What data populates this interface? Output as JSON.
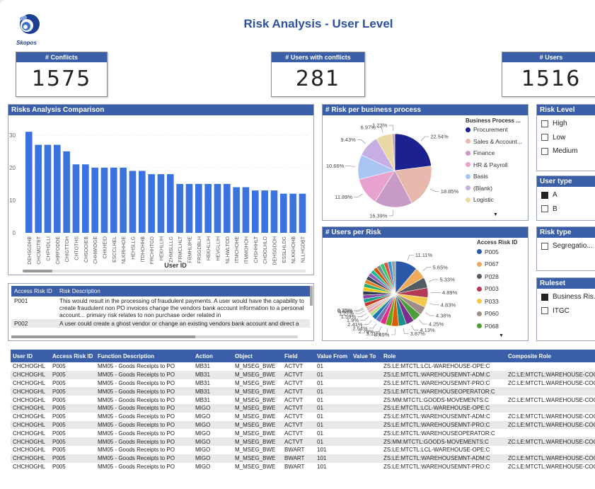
{
  "brand": {
    "name": "Skopos"
  },
  "page_title": "Risk Analysis - User Level",
  "kpis": [
    {
      "label": "# Conflicts",
      "value": "1575"
    },
    {
      "label": "# Users with conflicts",
      "value": "281"
    },
    {
      "label": "# Users",
      "value": "1516"
    }
  ],
  "risks_chart": {
    "title": "Risks Analysis Comparison",
    "x_axis_title": "User ID",
    "y_ticks": [
      "0",
      "10",
      "20",
      "30"
    ]
  },
  "business_process_chart": {
    "title": "# Risk per business process",
    "legend_title": "Business Process ...",
    "slices": [
      {
        "label": "Procurement",
        "value": 22.54,
        "pct": "22.54%",
        "color": "#1c2190"
      },
      {
        "label": "Sales & Account...",
        "value": 18.85,
        "pct": "18.85%",
        "color": "#e8b8ad"
      },
      {
        "label": "Finance",
        "value": 16.39,
        "pct": "16.39%",
        "color": "#c89ac6"
      },
      {
        "label": "HR & Payroll",
        "value": 11.89,
        "pct": "11.89%",
        "color": "#e8a2cf"
      },
      {
        "label": "Basis",
        "value": 10.66,
        "pct": "10.66%",
        "color": "#a9c5f3"
      },
      {
        "label": "(Blank)",
        "value": 9.43,
        "pct": "9.43%",
        "color": "#c6aee3"
      },
      {
        "label": "Logistic",
        "value": 6.97,
        "pct": "6.97%",
        "color": "#ebd9a5"
      },
      {
        "label": "",
        "value": 1.23,
        "pct": "1.23%",
        "color": "#d7a0a0"
      }
    ]
  },
  "users_per_risk_chart": {
    "title": "# Users per Risk",
    "legend_title": "Access Risk ID",
    "legend": [
      {
        "label": "P005",
        "color": "#2a57a8"
      },
      {
        "label": "P067",
        "color": "#f0ab5a"
      },
      {
        "label": "P028",
        "color": "#555b63"
      },
      {
        "label": "P003",
        "color": "#b43b56"
      },
      {
        "label": "P033",
        "color": "#f3c84b"
      },
      {
        "label": "P060",
        "color": "#a08e86"
      },
      {
        "label": "P068",
        "color": "#4c9e38"
      }
    ],
    "labeled_slices": [
      {
        "value": 11.11,
        "pct": "11.11%",
        "color": "#2a57a8"
      },
      {
        "value": 5.65,
        "pct": "5.65%",
        "color": "#f0ab5a"
      },
      {
        "value": 5.33,
        "pct": "5.33%",
        "color": "#555b63"
      },
      {
        "value": 4.89,
        "pct": "4.89%",
        "color": "#b43b56"
      },
      {
        "value": 4.83,
        "pct": "4.83%",
        "color": "#f3c84b"
      },
      {
        "value": 4.38,
        "pct": "4.38%",
        "color": "#a08e86"
      },
      {
        "value": 4.25,
        "pct": "4.25%",
        "color": "#4c9e38"
      },
      {
        "value": 4.13,
        "pct": "4.13%",
        "color": "#7a2f8c"
      },
      {
        "value": 3.87,
        "pct": "3.87%",
        "color": "#1b8f8a"
      },
      {
        "value": 3.49,
        "pct": "3.49%",
        "color": "#d95f02"
      },
      {
        "value": 3.11,
        "pct": "3.11%",
        "color": "#66a61e"
      },
      {
        "value": 2.79,
        "pct": "2.79%",
        "color": "#e7298a"
      },
      {
        "value": 2.54,
        "pct": "2.54%",
        "color": "#7570b3"
      },
      {
        "value": 2.41,
        "pct": "2.41%",
        "color": "#1f78b4"
      },
      {
        "value": 1.9,
        "pct": "1.9%",
        "color": "#b2df8a"
      },
      {
        "value": 1.59,
        "pct": "1.59%",
        "color": "#fb9a99"
      },
      {
        "value": 1.27,
        "pct": "1.27%",
        "color": "#cab2d6"
      },
      {
        "value": 0.63,
        "pct": "0.63%",
        "color": "#ff7f00"
      },
      {
        "value": 0.25,
        "pct": "0.25%",
        "color": "#6a3d9a"
      }
    ]
  },
  "slicers": {
    "risk_level": {
      "title": "Risk Level",
      "items": [
        {
          "label": "High",
          "checked": false
        },
        {
          "label": "Low",
          "checked": false
        },
        {
          "label": "Medium",
          "checked": false
        }
      ]
    },
    "user_type": {
      "title": "User type",
      "items": [
        {
          "label": "A",
          "checked": true
        },
        {
          "label": "B",
          "checked": false
        }
      ]
    },
    "risk_type": {
      "title": "Risk type",
      "items": [
        {
          "label": "Segregatio...",
          "checked": false
        }
      ]
    },
    "ruleset": {
      "title": "Ruleset",
      "items": [
        {
          "label": "Business Ris...",
          "checked": true
        },
        {
          "label": "ITGC",
          "checked": false
        }
      ]
    }
  },
  "risk_table": {
    "headers": {
      "id": "Access Risk ID",
      "desc": "Risk Description"
    },
    "rows": [
      {
        "id": "P001",
        "desc": "This would result in the processing of fraudulent payments. A user would have the capability to create fraudulent non PO invoices change the vendors bank account information to a personal account... primary risk relates to non purchase order related in"
      },
      {
        "id": "P002",
        "desc": "A user could create a ghost vendor or change an existing vendors bank account and direct a"
      }
    ]
  },
  "detail_table": {
    "headers": [
      "User ID",
      "Access Risk ID",
      "Function Description",
      "Action",
      "Object",
      "Field",
      "Value From",
      "Value To",
      "Role",
      "Composite Role"
    ],
    "rows": [
      [
        "CHCHOGHL",
        "P005",
        "MM05 - Goods Receipts to PO",
        "MB31",
        "M_MSEG_BWE",
        "ACTVT",
        "01",
        "",
        "ZS:LE:MTCTL:LCL-WAREHOUSE-OPE:C",
        ""
      ],
      [
        "CHCHOGHL",
        "P005",
        "MM05 - Goods Receipts to PO",
        "MB31",
        "M_MSEG_BWE",
        "ACTVT",
        "01",
        "",
        "ZS:LE:MTCTL:WAREHOUSEMNT-ADM:C",
        "ZC:LE:MTCTL:WAREHOUSE-COOR"
      ],
      [
        "CHCHOGHL",
        "P005",
        "MM05 - Goods Receipts to PO",
        "MB31",
        "M_MSEG_BWE",
        "ACTVT",
        "01",
        "",
        "ZS:LE:MTCTL:WAREHOUSEMNT-PRO:C",
        "ZC:LE:MTCTL:WAREHOUSE-COOR"
      ],
      [
        "CHCHOGHL",
        "P005",
        "MM05 - Goods Receipts to PO",
        "MB31",
        "M_MSEG_BWE",
        "ACTVT",
        "01",
        "",
        "ZS:LE:MTCTL:WAREHOUSEOPERATOR:C",
        ""
      ],
      [
        "CHCHOGHL",
        "P005",
        "MM05 - Goods Receipts to PO",
        "MB31",
        "M_MSEG_BWE",
        "ACTVT",
        "01",
        "",
        "ZS:MM:MTCTL:GOODS-MOVEMENTS:C",
        "ZC:LE:MTCTL:WAREHOUSE-COOR"
      ],
      [
        "CHCHOGHL",
        "P005",
        "MM05 - Goods Receipts to PO",
        "MIGO",
        "M_MSEG_BWE",
        "ACTVT",
        "01",
        "",
        "ZS:LE:MTCTL:LCL-WAREHOUSE-OPE:C",
        ""
      ],
      [
        "CHCHOGHL",
        "P005",
        "MM05 - Goods Receipts to PO",
        "MIGO",
        "M_MSEG_BWE",
        "ACTVT",
        "01",
        "",
        "ZS:LE:MTCTL:WAREHOUSEMNT-ADM:C",
        "ZC:LE:MTCTL:WAREHOUSE-COOR"
      ],
      [
        "CHCHOGHL",
        "P005",
        "MM05 - Goods Receipts to PO",
        "MIGO",
        "M_MSEG_BWE",
        "ACTVT",
        "01",
        "",
        "ZS:LE:MTCTL:WAREHOUSEMNT-PRO:C",
        "ZC:LE:MTCTL:WAREHOUSE-COOR"
      ],
      [
        "CHCHOGHL",
        "P005",
        "MM05 - Goods Receipts to PO",
        "MIGO",
        "M_MSEG_BWE",
        "ACTVT",
        "01",
        "",
        "ZS:LE:MTCTL:WAREHOUSEOPERATOR:C",
        ""
      ],
      [
        "CHCHOGHL",
        "P005",
        "MM05 - Goods Receipts to PO",
        "MIGO",
        "M_MSEG_BWE",
        "ACTVT",
        "01",
        "",
        "ZS:MM:MTCTL:GOODS-MOVEMENTS:C",
        "ZC:LE:MTCTL:WAREHOUSE-COOR"
      ],
      [
        "CHCHOGHL",
        "P005",
        "MM05 - Goods Receipts to PO",
        "MIGO",
        "M_MSEG_BWE",
        "BWART",
        "101",
        "",
        "ZS:LE:MTCTL:LCL-WAREHOUSE-OPE:C",
        ""
      ],
      [
        "CHCHOGHL",
        "P005",
        "MM05 - Goods Receipts to PO",
        "MIGO",
        "M_MSEG_BWE",
        "BWART",
        "101",
        "",
        "ZS:LE:MTCTL:WAREHOUSEMNT-ADM:C",
        "ZC:LE:MTCTL:WAREHOUSE-COOR"
      ],
      [
        "CHCHOGHL",
        "P005",
        "MM05 - Goods Receipts to PO",
        "MIGO",
        "M_MSEG_BWE",
        "BWART",
        "101",
        "",
        "ZS:LE:MTCTL:WAREHOUSEMNT-PRO:C",
        "ZC:LE:MTCTL:WAREHOUSE-COOR"
      ]
    ]
  },
  "chart_data": [
    {
      "type": "bar",
      "title": "Risks Analysis Comparison",
      "xlabel": "User ID",
      "ylabel": "",
      "ylim": [
        0,
        33
      ],
      "grid": true,
      "categories": [
        "DEHSGDHB",
        "CHCMOTBT",
        "CHPHDLLI",
        "CHRFODDE",
        "CHIGTTOH",
        "CHTOTHS",
        "CHSOOIEB",
        "CHHWIDGE",
        "CHKHEID",
        "ESCCLHEL",
        "NLKRHHOE",
        "HEHSLLG",
        "ITDHOHHB",
        "FRCHHTGD",
        "HEKHLLIH",
        "ZHMSLLLG",
        "FRMCLHLT",
        "FRMHL8HE",
        "FRSGDBLH",
        "HEKHLLIH",
        "HEVGLLIH",
        "NLHWLTOD",
        "ITMCHOHE",
        "ITMMOHOH",
        "CHSHHHLT",
        "CHDOLHLO",
        "DEHSGDOH",
        "ESSLHLDG",
        "NLKKHOHB",
        "NLLHGDBT"
      ],
      "values": [
        31,
        27,
        27,
        27,
        25,
        21,
        21,
        20,
        20,
        20,
        20,
        19,
        19,
        18,
        18,
        18,
        15,
        15,
        15,
        15,
        15,
        15,
        14,
        14,
        13,
        13,
        13,
        12,
        12,
        12
      ]
    },
    {
      "type": "pie",
      "title": "# Risk per business process",
      "categories": [
        "Procurement",
        "Sales & Account...",
        "Finance",
        "HR & Payroll",
        "Basis",
        "(Blank)",
        "Logistic",
        ""
      ],
      "values": [
        22.54,
        18.85,
        16.39,
        11.89,
        10.66,
        9.43,
        6.97,
        1.23
      ]
    },
    {
      "type": "pie",
      "title": "# Users per Risk",
      "categories": [
        "P005",
        "P067",
        "P028",
        "P003",
        "P033",
        "P060",
        "P068"
      ],
      "values": [
        11.11,
        5.65,
        5.33,
        4.89,
        4.83,
        4.38,
        4.25,
        4.13,
        3.87,
        3.49,
        3.11,
        2.79,
        2.54,
        2.41,
        1.9,
        1.59,
        1.27,
        0.63,
        0.25
      ]
    }
  ]
}
